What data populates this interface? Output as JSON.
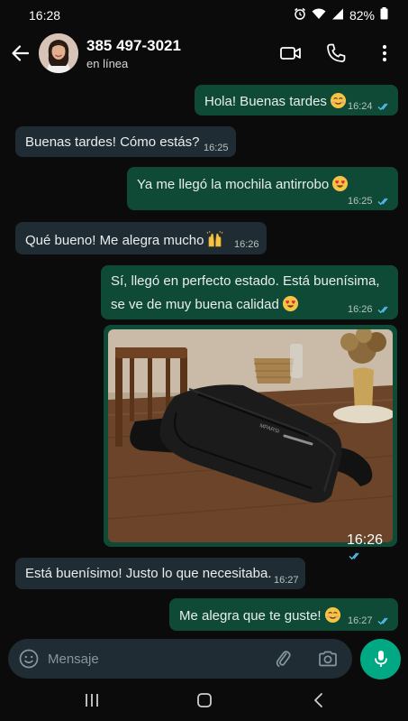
{
  "status_bar": {
    "time": "16:28",
    "battery": "82%",
    "icons": [
      "alarm-icon",
      "wifi-icon",
      "signal-icon",
      "battery-icon"
    ]
  },
  "header": {
    "contact_name": "385 497-3021",
    "contact_status": "en línea",
    "icons": [
      "back-arrow-icon",
      "video-call-icon",
      "phone-icon",
      "more-options-icon"
    ]
  },
  "messages": [
    {
      "direction": "out",
      "text": "Hola! Buenas tardes",
      "emoji": "smiling-face",
      "time": "16:24",
      "read": true
    },
    {
      "direction": "in",
      "text": "Buenas tardes! Cómo estás?",
      "time": "16:25"
    },
    {
      "direction": "out",
      "text": "Ya me llegó la mochila antirrobo",
      "emoji": "heart-eyes",
      "time": "16:25",
      "read": true
    },
    {
      "direction": "in",
      "text": "Qué bueno! Me alegra mucho",
      "emoji": "raising-hands",
      "time": "16:26"
    },
    {
      "direction": "out",
      "lines": [
        "Sí, llegó en perfecto estado. Está buenísima,",
        "se ve de muy buena calidad"
      ],
      "emoji": "heart-eyes",
      "time": "16:26",
      "read": true
    },
    {
      "direction": "out",
      "type": "image",
      "image_brand_text": "MPARSI",
      "time": "16:26",
      "read": true
    },
    {
      "direction": "in",
      "text": "Está buenísimo! Justo lo que necesitaba.",
      "time": "16:27"
    },
    {
      "direction": "out",
      "text": "Me alegra que te guste!",
      "emoji": "smiling-face",
      "time": "16:27",
      "read": true
    }
  ],
  "composer": {
    "placeholder": "Mensaje",
    "icons": [
      "emoji-icon",
      "attach-icon",
      "camera-icon",
      "mic-icon"
    ]
  },
  "nav": {
    "icons": [
      "recent-apps-icon",
      "home-icon",
      "back-icon"
    ]
  },
  "colors": {
    "background": "#0b0b0b",
    "incoming_bubble": "#1f2c33",
    "outgoing_bubble": "#0e4a36",
    "accent": "#00a884",
    "read_ticks": "#53bdeb"
  }
}
